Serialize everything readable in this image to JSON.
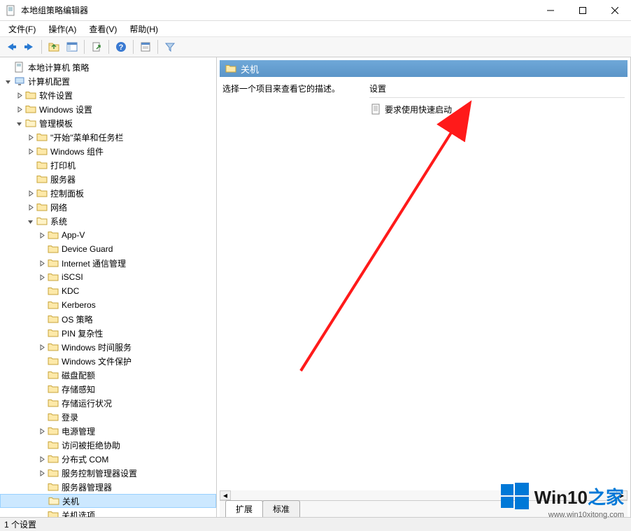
{
  "window": {
    "title": "本地组策略编辑器"
  },
  "menubar": [
    {
      "label": "文件(F)"
    },
    {
      "label": "操作(A)"
    },
    {
      "label": "查看(V)"
    },
    {
      "label": "帮助(H)"
    }
  ],
  "tree": {
    "root": {
      "label": "本地计算机 策略"
    },
    "computer_config": {
      "label": "计算机配置"
    },
    "software_settings": {
      "label": "软件设置"
    },
    "windows_settings": {
      "label": "Windows 设置"
    },
    "admin_templates": {
      "label": "管理模板"
    },
    "system": {
      "label": "系统"
    },
    "items_l2": [
      {
        "label": "\"开始\"菜单和任务栏",
        "expandable": true
      },
      {
        "label": "Windows 组件",
        "expandable": true
      },
      {
        "label": "打印机",
        "expandable": false
      },
      {
        "label": "服务器",
        "expandable": false
      },
      {
        "label": "控制面板",
        "expandable": true
      },
      {
        "label": "网络",
        "expandable": true
      }
    ],
    "items_l3": [
      {
        "label": "App-V",
        "expandable": true
      },
      {
        "label": "Device Guard",
        "expandable": false
      },
      {
        "label": "Internet 通信管理",
        "expandable": true
      },
      {
        "label": "iSCSI",
        "expandable": true
      },
      {
        "label": "KDC",
        "expandable": false
      },
      {
        "label": "Kerberos",
        "expandable": false
      },
      {
        "label": "OS 策略",
        "expandable": false
      },
      {
        "label": "PIN 复杂性",
        "expandable": false
      },
      {
        "label": "Windows 时间服务",
        "expandable": true
      },
      {
        "label": "Windows 文件保护",
        "expandable": false
      },
      {
        "label": "磁盘配额",
        "expandable": false
      },
      {
        "label": "存储感知",
        "expandable": false
      },
      {
        "label": "存储运行状况",
        "expandable": false
      },
      {
        "label": "登录",
        "expandable": false
      },
      {
        "label": "电源管理",
        "expandable": true
      },
      {
        "label": "访问被拒绝协助",
        "expandable": false
      },
      {
        "label": "分布式 COM",
        "expandable": true
      },
      {
        "label": "服务控制管理器设置",
        "expandable": true
      },
      {
        "label": "服务器管理器",
        "expandable": false
      },
      {
        "label": "关机",
        "expandable": false,
        "selected": true
      },
      {
        "label": "关机选项",
        "expandable": false
      }
    ]
  },
  "content": {
    "header": "关机",
    "description_prompt": "选择一个项目来查看它的描述。",
    "settings_header": "设置",
    "settings_items": [
      {
        "label": "要求使用快速启动"
      }
    ],
    "tabs": [
      {
        "label": "扩展",
        "active": true
      },
      {
        "label": "标准",
        "active": false
      }
    ]
  },
  "statusbar": {
    "text": "1 个设置"
  },
  "watermark": {
    "brand_main": "Win10",
    "brand_sub": "之家",
    "url": "www.win10xitong.com"
  }
}
